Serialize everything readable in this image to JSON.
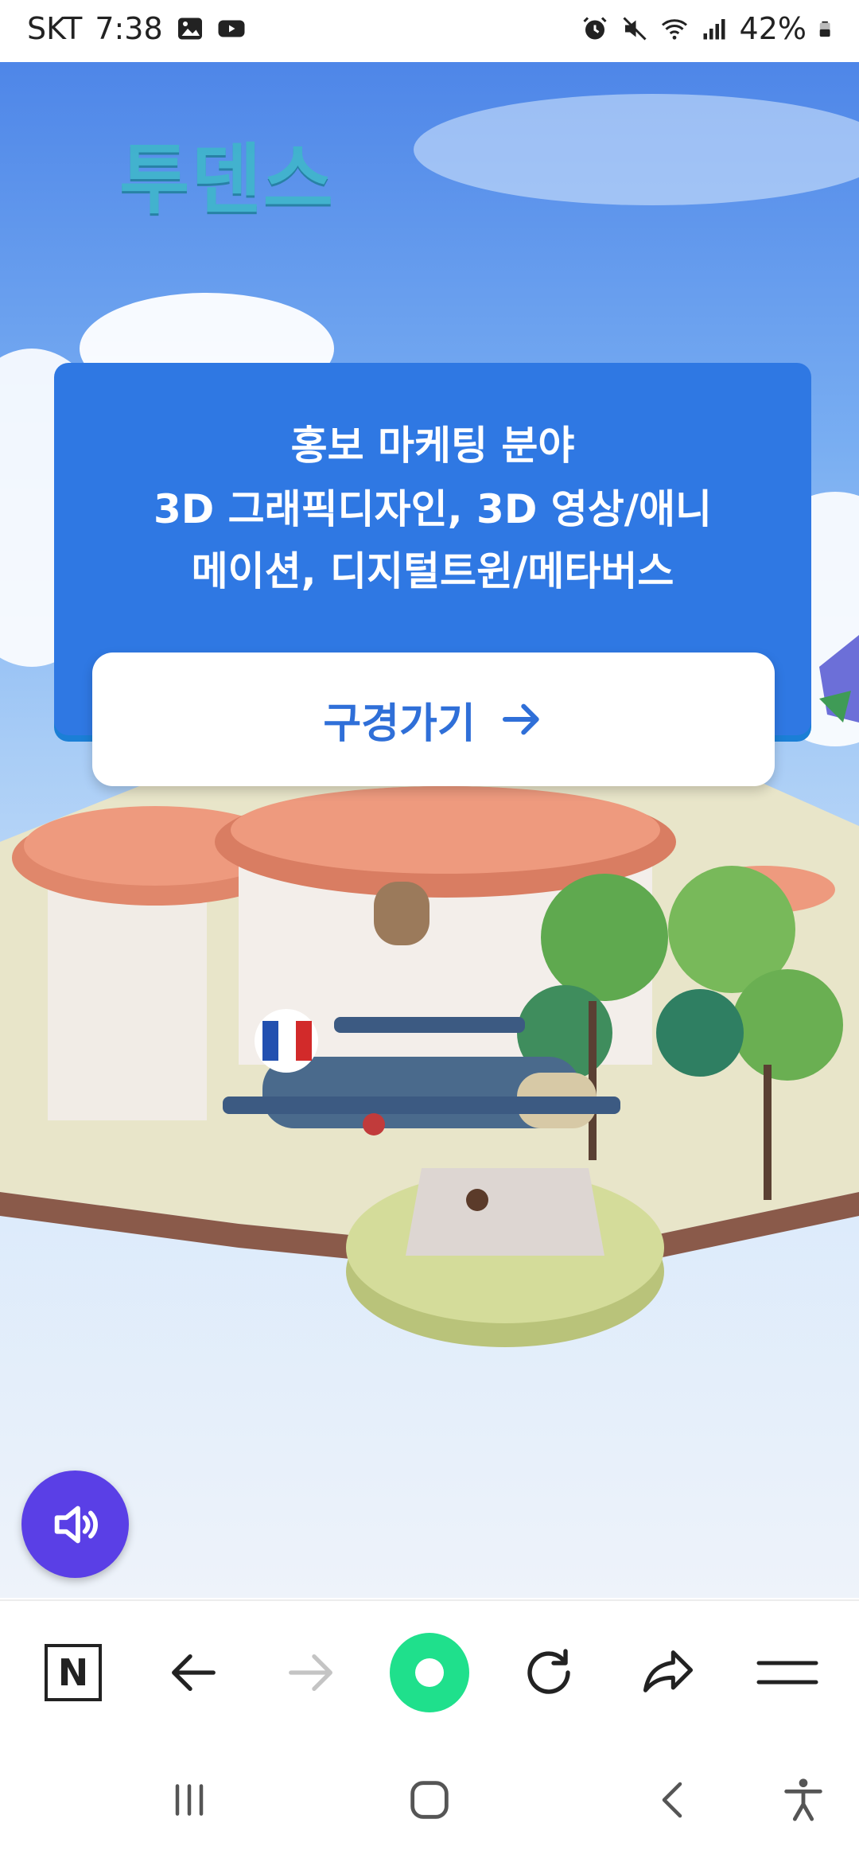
{
  "status_bar": {
    "carrier": "SKT",
    "time": "7:38",
    "battery": "42%",
    "icons": [
      "gallery-icon",
      "youtube-icon",
      "alarm-icon",
      "mute-icon",
      "wifi-icon",
      "signal-icon",
      "battery-icon"
    ]
  },
  "page": {
    "logo_title": "투덴스",
    "promo": {
      "line1": "홍보 마케팅 분야",
      "line2": "3D 그래픽디자인, 3D 영상/애니",
      "line3": "메이션, 디지털트윈/메타버스"
    },
    "tour_button_label": "구경가기",
    "colors": {
      "card": "#2f78e3",
      "button_text": "#2f6fd8",
      "audio_button": "#5a3fe6",
      "home_dot": "#1fe08c"
    }
  },
  "browser_toolbar": {
    "icons": [
      "naver-n-icon",
      "back-arrow-icon",
      "forward-arrow-icon",
      "green-dot-home-icon",
      "reload-icon",
      "share-icon",
      "menu-icon"
    ],
    "naver_letter": "N"
  },
  "nav_bar": {
    "icons": [
      "recent-apps-icon",
      "home-icon",
      "back-icon",
      "accessibility-icon"
    ]
  }
}
